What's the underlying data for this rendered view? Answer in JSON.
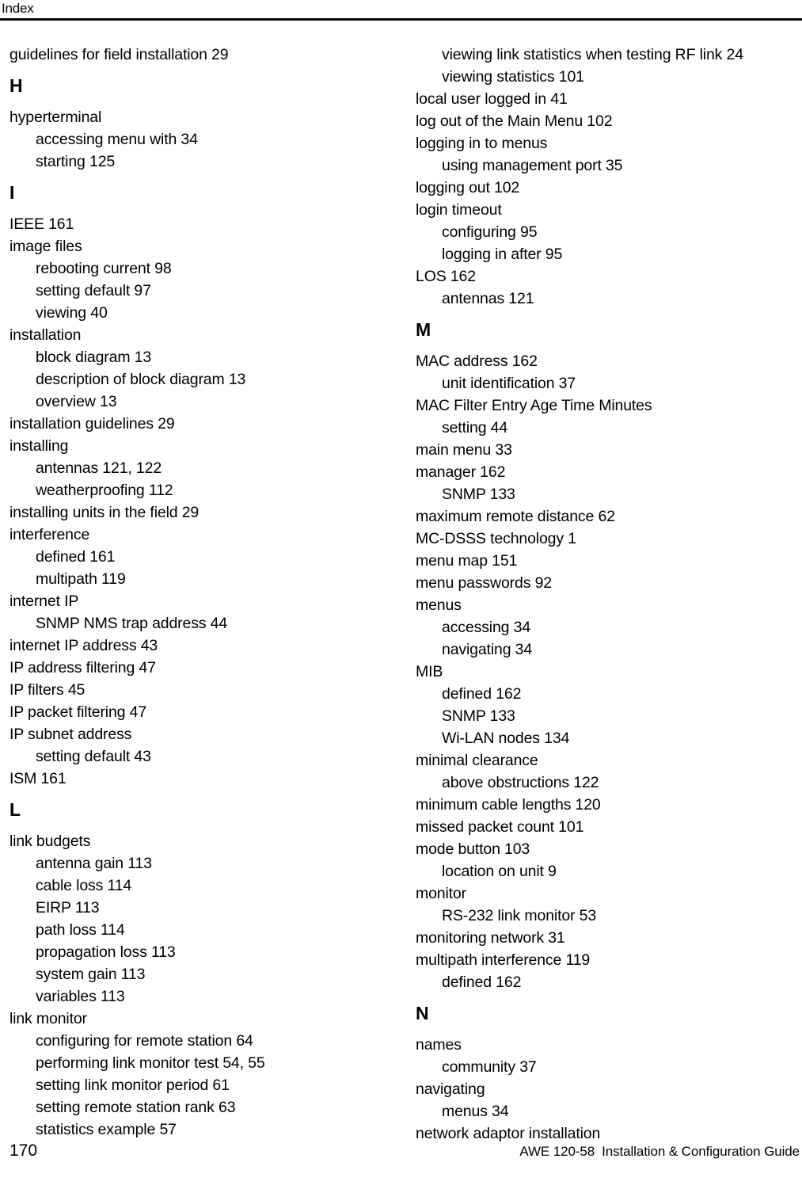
{
  "header": {
    "title": "Index"
  },
  "footer": {
    "page_number": "170",
    "doc_code": "AWE 120-58",
    "guide_title": "Installation & Configuration Guide"
  },
  "columns": {
    "left": [
      {
        "type": "entry",
        "level": 1,
        "text": "guidelines for field installation 29"
      },
      {
        "type": "heading",
        "text": "H"
      },
      {
        "type": "entry",
        "level": 1,
        "text": "hyperterminal"
      },
      {
        "type": "entry",
        "level": 2,
        "text": "accessing menu with 34"
      },
      {
        "type": "entry",
        "level": 2,
        "text": "starting 125"
      },
      {
        "type": "heading",
        "text": "I"
      },
      {
        "type": "entry",
        "level": 1,
        "text": "IEEE 161"
      },
      {
        "type": "entry",
        "level": 1,
        "text": "image files"
      },
      {
        "type": "entry",
        "level": 2,
        "text": "rebooting current 98"
      },
      {
        "type": "entry",
        "level": 2,
        "text": "setting default 97"
      },
      {
        "type": "entry",
        "level": 2,
        "text": "viewing 40"
      },
      {
        "type": "entry",
        "level": 1,
        "text": "installation"
      },
      {
        "type": "entry",
        "level": 2,
        "text": "block diagram 13"
      },
      {
        "type": "entry",
        "level": 2,
        "text": "description of block diagram 13"
      },
      {
        "type": "entry",
        "level": 2,
        "text": "overview 13"
      },
      {
        "type": "entry",
        "level": 1,
        "text": "installation guidelines 29"
      },
      {
        "type": "entry",
        "level": 1,
        "text": "installing"
      },
      {
        "type": "entry",
        "level": 2,
        "text": "antennas 121, 122"
      },
      {
        "type": "entry",
        "level": 2,
        "text": "weatherproofing 112"
      },
      {
        "type": "entry",
        "level": 1,
        "text": "installing units in the field 29"
      },
      {
        "type": "entry",
        "level": 1,
        "text": "interference"
      },
      {
        "type": "entry",
        "level": 2,
        "text": "defined 161"
      },
      {
        "type": "entry",
        "level": 2,
        "text": "multipath 119"
      },
      {
        "type": "entry",
        "level": 1,
        "text": "internet IP"
      },
      {
        "type": "entry",
        "level": 2,
        "text": "SNMP NMS trap address 44"
      },
      {
        "type": "entry",
        "level": 1,
        "text": "internet IP address 43"
      },
      {
        "type": "entry",
        "level": 1,
        "text": "IP address filtering 47"
      },
      {
        "type": "entry",
        "level": 1,
        "text": "IP filters 45"
      },
      {
        "type": "entry",
        "level": 1,
        "text": "IP packet filtering 47"
      },
      {
        "type": "entry",
        "level": 1,
        "text": "IP subnet address"
      },
      {
        "type": "entry",
        "level": 2,
        "text": "setting default 43"
      },
      {
        "type": "entry",
        "level": 1,
        "text": "ISM 161"
      },
      {
        "type": "heading",
        "text": "L"
      },
      {
        "type": "entry",
        "level": 1,
        "text": "link budgets"
      },
      {
        "type": "entry",
        "level": 2,
        "text": "antenna gain 113"
      },
      {
        "type": "entry",
        "level": 2,
        "text": "cable loss 114"
      },
      {
        "type": "entry",
        "level": 2,
        "text": "EIRP 113"
      },
      {
        "type": "entry",
        "level": 2,
        "text": "path loss 114"
      },
      {
        "type": "entry",
        "level": 2,
        "text": "propagation loss 113"
      },
      {
        "type": "entry",
        "level": 2,
        "text": "system gain 113"
      },
      {
        "type": "entry",
        "level": 2,
        "text": "variables 113"
      },
      {
        "type": "entry",
        "level": 1,
        "text": "link monitor"
      },
      {
        "type": "entry",
        "level": 2,
        "text": "configuring for remote station 64"
      },
      {
        "type": "entry",
        "level": 2,
        "text": "performing link monitor test 54, 55"
      },
      {
        "type": "entry",
        "level": 2,
        "text": "setting link monitor period 61"
      },
      {
        "type": "entry",
        "level": 2,
        "text": "setting remote station rank 63"
      },
      {
        "type": "entry",
        "level": 2,
        "text": "statistics example 57"
      }
    ],
    "right": [
      {
        "type": "entry",
        "level": 2,
        "text": "viewing link statistics when testing RF link 24"
      },
      {
        "type": "entry",
        "level": 2,
        "text": "viewing statistics 101"
      },
      {
        "type": "entry",
        "level": 1,
        "text": "local user logged in 41"
      },
      {
        "type": "entry",
        "level": 1,
        "text": "log out of the Main Menu 102"
      },
      {
        "type": "entry",
        "level": 1,
        "text": "logging in to menus"
      },
      {
        "type": "entry",
        "level": 2,
        "text": "using management port 35"
      },
      {
        "type": "entry",
        "level": 1,
        "text": "logging out 102"
      },
      {
        "type": "entry",
        "level": 1,
        "text": "login timeout"
      },
      {
        "type": "entry",
        "level": 2,
        "text": "configuring 95"
      },
      {
        "type": "entry",
        "level": 2,
        "text": "logging in after 95"
      },
      {
        "type": "entry",
        "level": 1,
        "text": "LOS 162"
      },
      {
        "type": "entry",
        "level": 2,
        "text": "antennas 121"
      },
      {
        "type": "heading",
        "text": "M"
      },
      {
        "type": "entry",
        "level": 1,
        "text": "MAC address 162"
      },
      {
        "type": "entry",
        "level": 2,
        "text": "unit identification 37"
      },
      {
        "type": "entry",
        "level": 1,
        "text": "MAC Filter Entry Age Time Minutes"
      },
      {
        "type": "entry",
        "level": 2,
        "text": "setting 44"
      },
      {
        "type": "entry",
        "level": 1,
        "text": "main menu 33"
      },
      {
        "type": "entry",
        "level": 1,
        "text": "manager 162"
      },
      {
        "type": "entry",
        "level": 2,
        "text": "SNMP 133"
      },
      {
        "type": "entry",
        "level": 1,
        "text": "maximum remote distance 62"
      },
      {
        "type": "entry",
        "level": 1,
        "text": "MC-DSSS technology 1"
      },
      {
        "type": "entry",
        "level": 1,
        "text": "menu map 151"
      },
      {
        "type": "entry",
        "level": 1,
        "text": "menu passwords 92"
      },
      {
        "type": "entry",
        "level": 1,
        "text": "menus"
      },
      {
        "type": "entry",
        "level": 2,
        "text": "accessing 34"
      },
      {
        "type": "entry",
        "level": 2,
        "text": "navigating 34"
      },
      {
        "type": "entry",
        "level": 1,
        "text": "MIB"
      },
      {
        "type": "entry",
        "level": 2,
        "text": "defined 162"
      },
      {
        "type": "entry",
        "level": 2,
        "text": "SNMP 133"
      },
      {
        "type": "entry",
        "level": 2,
        "text": "Wi-LAN nodes 134"
      },
      {
        "type": "entry",
        "level": 1,
        "text": "minimal clearance"
      },
      {
        "type": "entry",
        "level": 2,
        "text": "above obstructions 122"
      },
      {
        "type": "entry",
        "level": 1,
        "text": "minimum cable lengths 120"
      },
      {
        "type": "entry",
        "level": 1,
        "text": "missed packet count 101"
      },
      {
        "type": "entry",
        "level": 1,
        "text": "mode button 103"
      },
      {
        "type": "entry",
        "level": 2,
        "text": "location on unit 9"
      },
      {
        "type": "entry",
        "level": 1,
        "text": "monitor"
      },
      {
        "type": "entry",
        "level": 2,
        "text": "RS-232 link monitor 53"
      },
      {
        "type": "entry",
        "level": 1,
        "text": "monitoring network 31"
      },
      {
        "type": "entry",
        "level": 1,
        "text": "multipath interference 119"
      },
      {
        "type": "entry",
        "level": 2,
        "text": "defined 162"
      },
      {
        "type": "heading",
        "text": "N"
      },
      {
        "type": "entry",
        "level": 1,
        "text": "names"
      },
      {
        "type": "entry",
        "level": 2,
        "text": "community 37"
      },
      {
        "type": "entry",
        "level": 1,
        "text": "navigating"
      },
      {
        "type": "entry",
        "level": 2,
        "text": "menus 34"
      },
      {
        "type": "entry",
        "level": 1,
        "text": "network adaptor installation"
      }
    ]
  }
}
